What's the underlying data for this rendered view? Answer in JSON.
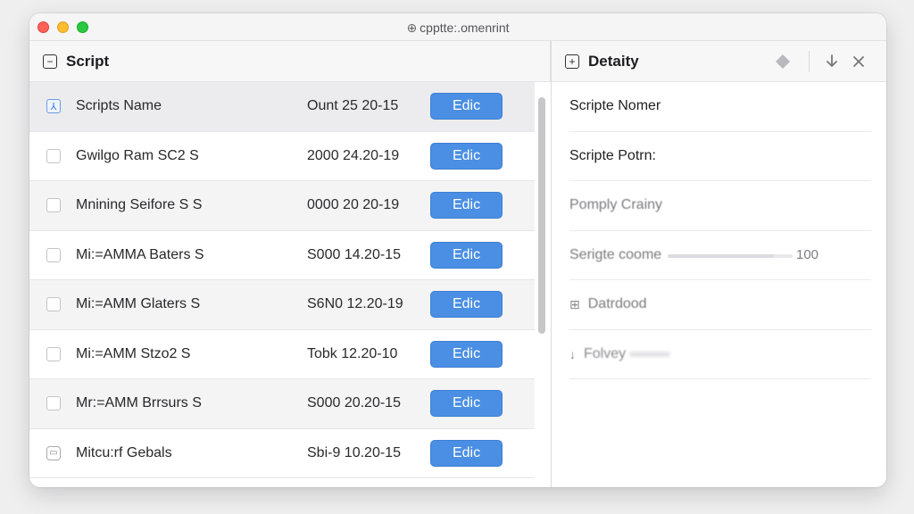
{
  "window": {
    "title": "cpptte:.omenrint",
    "title_icon": "link-icon",
    "traffic_colors": [
      "#fe5f57",
      "#febc2e",
      "#28c840"
    ]
  },
  "left_panel": {
    "title": "Script",
    "header_icon": "minus-square-icon",
    "accent_color": "#4a8fe3",
    "rows": [
      {
        "name": "Scripts Name",
        "date": "Ount 25 20-15",
        "edit_label": "Edic"
      },
      {
        "name": "Gwilgo Ram SC2 S",
        "date": "2000 24.20-19",
        "edit_label": "Edic"
      },
      {
        "name": "Mnining Seifore S S",
        "date": "0000 20 20-19",
        "edit_label": "Edic"
      },
      {
        "name": "Mi:=AMMA Baters S",
        "date": "S000 14.20-15",
        "edit_label": "Edic"
      },
      {
        "name": "Mi:=AMM Glaters S",
        "date": "S6N0 12.20-19",
        "edit_label": "Edic"
      },
      {
        "name": "Mi:=AMM Stzo2 S",
        "date": "Tobk 12.20-10",
        "edit_label": "Edic"
      },
      {
        "name": "Mr:=AMM Brrsurs S",
        "date": "S000 20.20-15",
        "edit_label": "Edic"
      },
      {
        "name": "Mitcu:rf Gebals",
        "date": "Sbi-9 10.20-15",
        "edit_label": "Edic"
      }
    ]
  },
  "right_panel": {
    "title": "Detaity",
    "header_icon": "plus-square-icon",
    "actions": [
      "diamond-icon",
      "download-icon",
      "close-icon"
    ],
    "items": [
      {
        "label": "Scripte Nomer"
      },
      {
        "label": "Scripte Potrn:"
      },
      {
        "label": "Pomply Crainy"
      },
      {
        "label": "Serigte coome",
        "progress": 0.85,
        "value": "100"
      },
      {
        "label": "Datrdood",
        "icon": "grid-icon"
      },
      {
        "label": "Folvey",
        "icon": "pin-icon"
      }
    ]
  }
}
